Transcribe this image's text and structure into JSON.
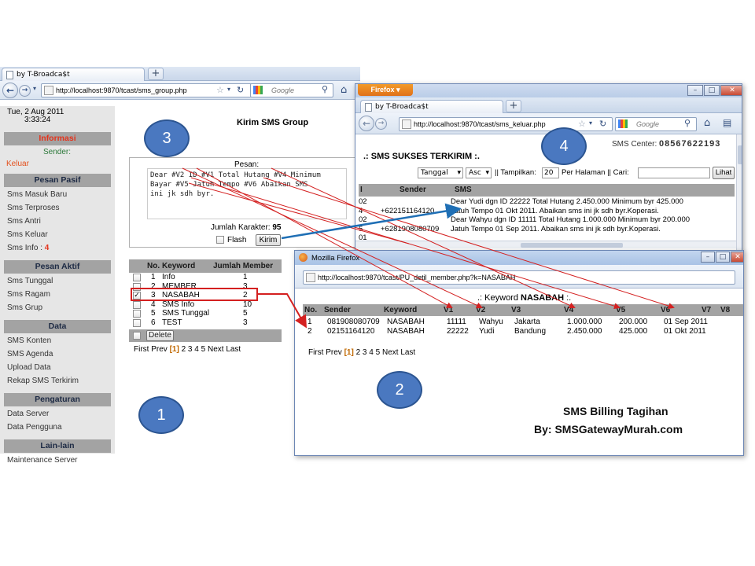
{
  "window1": {
    "tab_title": "by T-Broadca$t",
    "url": "http://localhost:9870/tcast/sms_group.php",
    "search_placeholder": "Google",
    "sidebar": {
      "date": "Tue, 2 Aug 2011",
      "time": "3:33:24",
      "informasi": "Informasi",
      "sender_label": "Sender:",
      "keluar": "Keluar",
      "sections": [
        {
          "title": "Pesan Pasif",
          "items": [
            "Sms Masuk Baru",
            "Sms Terproses",
            "Sms Antri",
            "Sms Keluar",
            "Sms Info : "
          ]
        },
        {
          "title": "Pesan Aktif",
          "items": [
            "Sms Tunggal",
            "Sms Ragam",
            "Sms Grup"
          ]
        },
        {
          "title": "Data",
          "items": [
            "SMS Konten",
            "SMS Agenda",
            "Upload Data",
            "Rekap SMS Terkirim"
          ]
        },
        {
          "title": "Pengaturan",
          "items": [
            "Data Server",
            "Data Pengguna"
          ]
        },
        {
          "title": "Lain-lain",
          "items": [
            "Maintenance Server"
          ]
        }
      ],
      "sms_info_count": "4"
    },
    "panel_title": "Kirim SMS Group",
    "pesan_label": "Pesan:",
    "message_lines": [
      "Dear #V2 ID #V1 Total Hutang #V4 Minimum",
      "Bayar #V5 Jatuh Tempo #V6 Abaikan SMS",
      "ini jk sdh byr."
    ],
    "jumlah_label": "Jumlah Karakter:",
    "jumlah_value": "95",
    "flash_label": "Flash",
    "kirim_label": "Kirim",
    "group_table": {
      "headers": [
        "No.",
        "Keyword",
        "Jumlah Member"
      ],
      "rows": [
        {
          "no": "1",
          "keyword": "Info",
          "jumlah": "1",
          "checked": false
        },
        {
          "no": "2",
          "keyword": "MEMBER",
          "jumlah": "3",
          "checked": false
        },
        {
          "no": "3",
          "keyword": "NASABAH",
          "jumlah": "2",
          "checked": true
        },
        {
          "no": "4",
          "keyword": "SMS Info",
          "jumlah": "10",
          "checked": false
        },
        {
          "no": "5",
          "keyword": "SMS Tunggal",
          "jumlah": "5",
          "checked": false
        },
        {
          "no": "6",
          "keyword": "TEST",
          "jumlah": "3",
          "checked": false
        }
      ],
      "delete_label": "Delete"
    },
    "pager": {
      "first": "First",
      "prev": "Prev",
      "current": "[1]",
      "pages": "2 3 4 5",
      "next": "Next",
      "last": "Last"
    }
  },
  "window4": {
    "firefox_button": "Firefox",
    "tab_title": "by T-Broadca$t",
    "url": "http://localhost:9870/tcast/sms_keluar.php",
    "search_placeholder": "Google",
    "sms_center_label": "SMS Center:",
    "sms_center_value": "08567622193",
    "heading": ".: SMS SUKSES TERKIRIM :.",
    "filter": {
      "sort_field": "Tanggal",
      "sort_dir": "Asc",
      "tampilkan_label": "|| Tampilkan:",
      "tampilkan_value": "20",
      "per_halaman": "Per Halaman || Cari:",
      "lihat": "Lihat"
    },
    "table_headers": [
      "I",
      "Sender",
      "SMS"
    ],
    "rows": [
      {
        "i": "02",
        "sender": "",
        "sms": "Dear Yudi dgn ID 22222 Total Hutang 2.450.000 Minimum byr 425.000"
      },
      {
        "i": "4",
        "sender": "+622151164120",
        "sms": "Jatuh Tempo 01 Okt 2011. Abaikan sms ini jk sdh byr.Koperasi."
      },
      {
        "i": "02",
        "sender": "",
        "sms": "Dear Wahyu dgn ID 11111 Total Hutang 1.000.000 Minimum byr 200.000"
      },
      {
        "i": "5",
        "sender": "+6281908080709",
        "sms": "Jatuh Tempo 01 Sep 2011. Abaikan sms ini jk sdh byr.Koperasi."
      },
      {
        "i": "01",
        "sender": "",
        "sms": ""
      }
    ]
  },
  "window2": {
    "title": "Mozilla Firefox",
    "url": "http://localhost:9870/tcast/PU_detil_member.php?k=NASABAH",
    "keyword_prefix": ".: Keyword",
    "keyword_value": "NASABAH",
    "keyword_suffix": ":.",
    "headers": [
      "No.",
      "Sender",
      "Keyword",
      "V1",
      "V2",
      "V3",
      "V4",
      "V5",
      "V6",
      "V7",
      "V8"
    ],
    "rows": [
      [
        "1",
        "081908080709",
        "NASABAH",
        "11111",
        "Wahyu",
        "Jakarta",
        "1.000.000",
        "200.000",
        "01 Sep 2011",
        "",
        ""
      ],
      [
        "2",
        "02151164120",
        "NASABAH",
        "22222",
        "Yudi",
        "Bandung",
        "2.450.000",
        "425.000",
        "01 Okt 2011",
        "",
        ""
      ]
    ],
    "pager": {
      "first": "First",
      "prev": "Prev",
      "current": "[1]",
      "pages": "2 3 4 5",
      "next": "Next",
      "last": "Last"
    }
  },
  "callouts": [
    "1",
    "2",
    "3",
    "4"
  ],
  "footer": {
    "line1": "SMS Billing Tagihan",
    "line2": "By: SMSGatewayMurah.com"
  },
  "colors": {
    "accent_red": "#e4331c",
    "arrow_red": "#d42020",
    "arrow_blue": "#1f6fb5",
    "circle_blue": "#4a78c0"
  }
}
